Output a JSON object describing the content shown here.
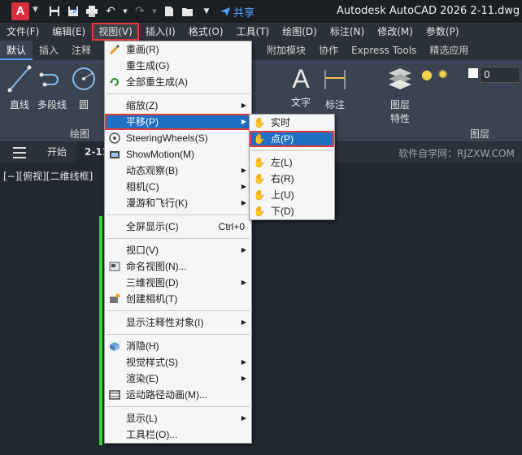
{
  "title_bar": {
    "app_logo": "A",
    "share_label": "共享",
    "window_title": "Autodesk AutoCAD 2026    2-11.dwg",
    "qat_icons": [
      "save-icon",
      "save-as-icon",
      "print-icon",
      "undo-icon",
      "redo-icon",
      "new-icon",
      "open-icon",
      "customize-icon",
      "share-icon"
    ]
  },
  "menubar": {
    "items": [
      "文件(F)",
      "编辑(E)",
      "视图(V)",
      "插入(I)",
      "格式(O)",
      "工具(T)",
      "绘图(D)",
      "标注(N)",
      "修改(M)",
      "参数(P)"
    ],
    "active": "视图(V)"
  },
  "ribbon": {
    "tabs": [
      "默认",
      "插入",
      "注释",
      "附加模块",
      "协作",
      "Express Tools",
      "精选应用"
    ],
    "active_tab": "默认",
    "tools": {
      "line": "直线",
      "polyline": "多段线",
      "circle": "圆",
      "text": "文字",
      "dimension": "标注",
      "layer_properties_1": "图层",
      "layer_properties_2": "特性"
    },
    "panels": {
      "draw": "绘图",
      "layers": "图层"
    },
    "layer_dropdown_value": "0"
  },
  "file_tabs": {
    "start": "开始",
    "current": "2-11",
    "watermark": "软件自学网：RJZXW.COM"
  },
  "viewport_label": "[−][俯视][二维线框]",
  "view_menu": {
    "items": [
      {
        "label": "重画(R)",
        "icon": "redraw-icon"
      },
      {
        "label": "重生成(G)"
      },
      {
        "label": "全部重生成(A)",
        "icon": "regen-all-icon"
      },
      {
        "sep": true
      },
      {
        "label": "缩放(Z)",
        "submenu": true
      },
      {
        "label": "平移(P)",
        "submenu": true,
        "highlight": true
      },
      {
        "label": "SteeringWheels(S)",
        "icon": "steering-wheel-icon"
      },
      {
        "label": "ShowMotion(M)",
        "icon": "showmotion-icon"
      },
      {
        "label": "动态观察(B)",
        "submenu": true
      },
      {
        "label": "相机(C)",
        "submenu": true
      },
      {
        "label": "漫游和飞行(K)",
        "submenu": true
      },
      {
        "sep": true
      },
      {
        "label": "全屏显示(C)",
        "shortcut": "Ctrl+0"
      },
      {
        "sep": true
      },
      {
        "label": "视口(V)",
        "submenu": true
      },
      {
        "label": "命名视图(N)...",
        "icon": "named-views-icon"
      },
      {
        "label": "三维视图(D)",
        "submenu": true
      },
      {
        "label": "创建相机(T)",
        "icon": "create-camera-icon"
      },
      {
        "sep": true
      },
      {
        "label": "显示注释性对象(I)",
        "submenu": true
      },
      {
        "sep": true
      },
      {
        "label": "消隐(H)",
        "icon": "hide-icon"
      },
      {
        "label": "视觉样式(S)",
        "submenu": true
      },
      {
        "label": "渲染(E)",
        "submenu": true
      },
      {
        "label": "运动路径动画(M)...",
        "icon": "motion-path-icon"
      },
      {
        "sep": true
      },
      {
        "label": "显示(L)",
        "submenu": true
      },
      {
        "label": "工具栏(O)..."
      }
    ]
  },
  "pan_submenu": {
    "items": [
      {
        "label": "实时",
        "icon": "hand-realtime-icon"
      },
      {
        "label": "点(P)",
        "icon": "hand-point-icon",
        "highlight": true
      },
      {
        "sep": true
      },
      {
        "label": "左(L)",
        "icon": "hand-left-icon"
      },
      {
        "label": "右(R)",
        "icon": "hand-right-icon"
      },
      {
        "label": "上(U)",
        "icon": "hand-up-icon"
      },
      {
        "label": "下(D)",
        "icon": "hand-down-icon"
      }
    ]
  }
}
